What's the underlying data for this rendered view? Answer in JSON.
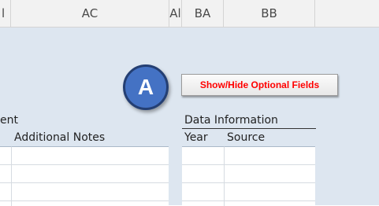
{
  "column_headers": {
    "left_partial": "l",
    "ac": "AC",
    "al_partial": "Al",
    "ba": "BA",
    "bb": "BB"
  },
  "callout": {
    "letter": "A"
  },
  "toggle_button": {
    "label": "Show/Hide Optional Fields",
    "text_color": "#ff0000"
  },
  "sections": {
    "left_partial": "ent",
    "data_information": "Data Information"
  },
  "field_headers": {
    "additional_notes": "Additional Notes",
    "year": "Year",
    "source": "Source"
  },
  "colors": {
    "sheet_background": "#dde6f0",
    "badge_fill": "#4472c4",
    "badge_border": "#243f73"
  }
}
